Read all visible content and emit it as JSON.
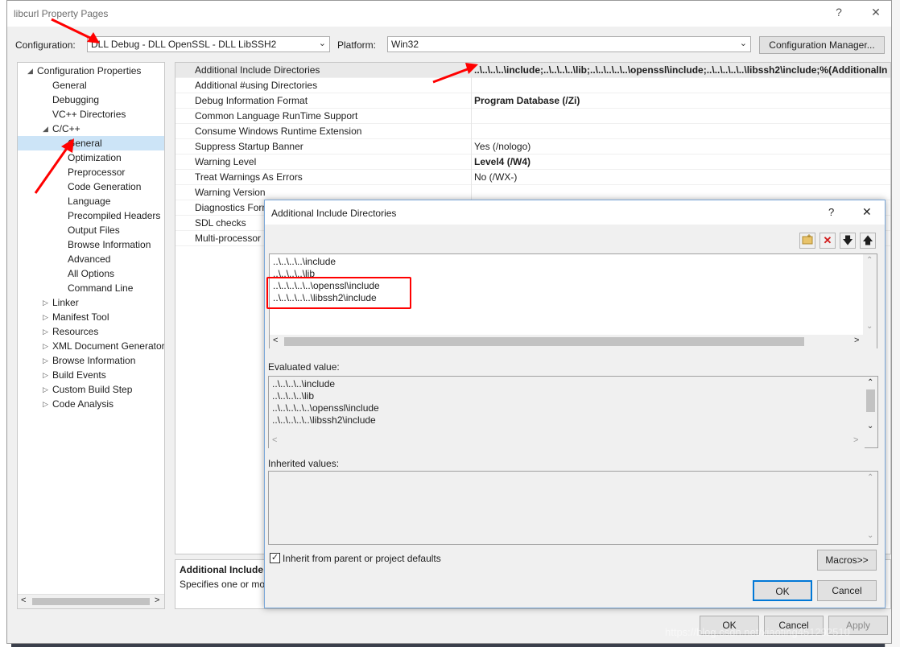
{
  "window": {
    "title": "libcurl Property Pages",
    "help": "?",
    "close": "✕"
  },
  "config": {
    "config_label": "Configuration:",
    "config_value": "DLL Debug - DLL OpenSSL - DLL LibSSH2",
    "platform_label": "Platform:",
    "platform_value": "Win32",
    "manager_button": "Configuration Manager..."
  },
  "tree": {
    "root": "Configuration Properties",
    "items": [
      "General",
      "Debugging",
      "VC++ Directories"
    ],
    "cpp": "C/C++",
    "cpp_children": [
      "General",
      "Optimization",
      "Preprocessor",
      "Code Generation",
      "Language",
      "Precompiled Headers",
      "Output Files",
      "Browse Information",
      "Advanced",
      "All Options",
      "Command Line"
    ],
    "others": [
      "Linker",
      "Manifest Tool",
      "Resources",
      "XML Document Generator",
      "Browse Information",
      "Build Events",
      "Custom Build Step",
      "Code Analysis"
    ]
  },
  "grid": {
    "rows": [
      {
        "name": "Additional Include Directories",
        "value": "..\\..\\..\\..\\include;..\\..\\..\\..\\lib;..\\..\\..\\..\\..\\openssl\\include;..\\..\\..\\..\\..\\libssh2\\include;%(AdditionalIn"
      },
      {
        "name": "Additional #using Directories",
        "value": ""
      },
      {
        "name": "Debug Information Format",
        "value": "Program Database (/Zi)"
      },
      {
        "name": "Common Language RunTime Support",
        "value": ""
      },
      {
        "name": "Consume Windows Runtime Extension",
        "value": ""
      },
      {
        "name": "Suppress Startup Banner",
        "value": "Yes (/nologo)"
      },
      {
        "name": "Warning Level",
        "value": "Level4 (/W4)"
      },
      {
        "name": "Treat Warnings As Errors",
        "value": "No (/WX-)"
      },
      {
        "name": "Warning Version",
        "value": ""
      },
      {
        "name": "Diagnostics Form",
        "value": ""
      },
      {
        "name": "SDL checks",
        "value": ""
      },
      {
        "name": "Multi-processor",
        "value": ""
      }
    ]
  },
  "description": {
    "title": "Additional Include D",
    "text": "Specifies one or mo"
  },
  "dialog": {
    "title": "Additional Include Directories",
    "help": "?",
    "close": "✕",
    "entries": [
      "..\\..\\..\\..\\include",
      "..\\..\\..\\..\\lib",
      "..\\..\\..\\..\\..\\openssl\\include",
      "..\\..\\..\\..\\..\\libssh2\\include"
    ],
    "evaluated_label": "Evaluated value:",
    "evaluated": [
      "..\\..\\..\\..\\include",
      "..\\..\\..\\..\\lib",
      "..\\..\\..\\..\\..\\openssl\\include",
      "..\\..\\..\\..\\..\\libssh2\\include"
    ],
    "inherited_label": "Inherited values:",
    "inherit_checkbox": "Inherit from parent or project defaults",
    "macros_button": "Macros>>",
    "ok": "OK",
    "cancel": "Cancel"
  },
  "footer": {
    "ok": "OK",
    "cancel": "Cancel",
    "apply": "Apply"
  },
  "watermark": "https://blog.csdn.net/xiaoting451292510",
  "colors": {
    "accent": "#0078d7",
    "selection": "#cce4f7",
    "annotation": "#ff0000"
  }
}
